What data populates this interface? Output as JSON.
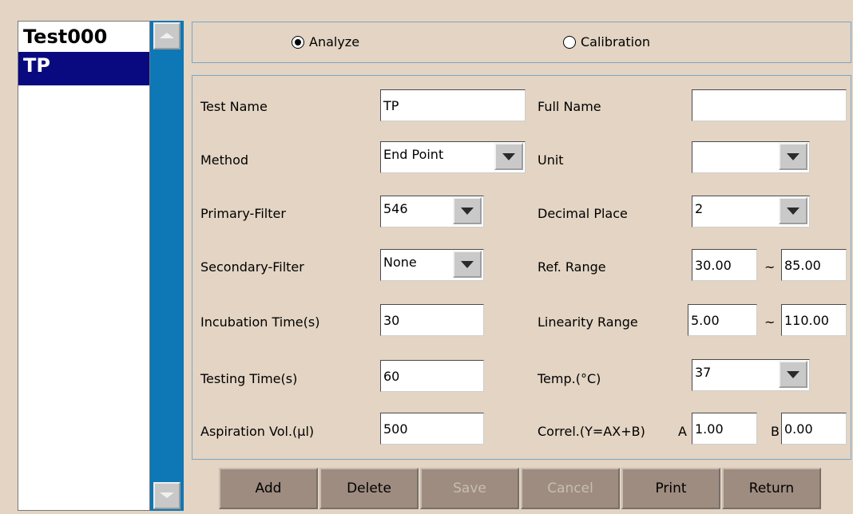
{
  "test_list": {
    "items": [
      {
        "label": "Test000",
        "selected": false
      },
      {
        "label": "TP",
        "selected": true
      }
    ]
  },
  "mode": {
    "analyze_label": "Analyze",
    "calibration_label": "Calibration",
    "selected": "Analyze"
  },
  "form": {
    "test_name_label": "Test Name",
    "test_name_value": "TP",
    "full_name_label": "Full Name",
    "full_name_value": "",
    "method_label": "Method",
    "method_value": "End Point",
    "unit_label": "Unit",
    "unit_value": "",
    "primary_filter_label": "Primary-Filter",
    "primary_filter_value": "546",
    "decimal_place_label": "Decimal Place",
    "decimal_place_value": "2",
    "secondary_filter_label": "Secondary-Filter",
    "secondary_filter_value": "None",
    "ref_range_label": "Ref. Range",
    "ref_range_low": "30.00",
    "ref_range_high": "85.00",
    "incubation_label": "Incubation Time(s)",
    "incubation_value": "30",
    "linearity_label": "Linearity Range",
    "linearity_low": "5.00",
    "linearity_high": "110.00",
    "testing_time_label": "Testing Time(s)",
    "testing_time_value": "60",
    "temp_label": "Temp.(°C)",
    "temp_value": "37",
    "aspiration_label": "Aspiration Vol.(µl)",
    "aspiration_value": "500",
    "correl_label": "Correl.(Y=AX+B)",
    "correl_a_label": "A",
    "correl_a_value": "1.00",
    "correl_b_label": "B",
    "correl_b_value": "0.00",
    "range_sep": "~"
  },
  "buttons": {
    "add": "Add",
    "delete": "Delete",
    "save": "Save",
    "cancel": "Cancel",
    "print": "Print",
    "return": "Return"
  },
  "colors": {
    "background": "#e3d4c3",
    "selection": "#0a0a80",
    "scrollbar": "#0e77b6",
    "button": "#9e8c80"
  }
}
